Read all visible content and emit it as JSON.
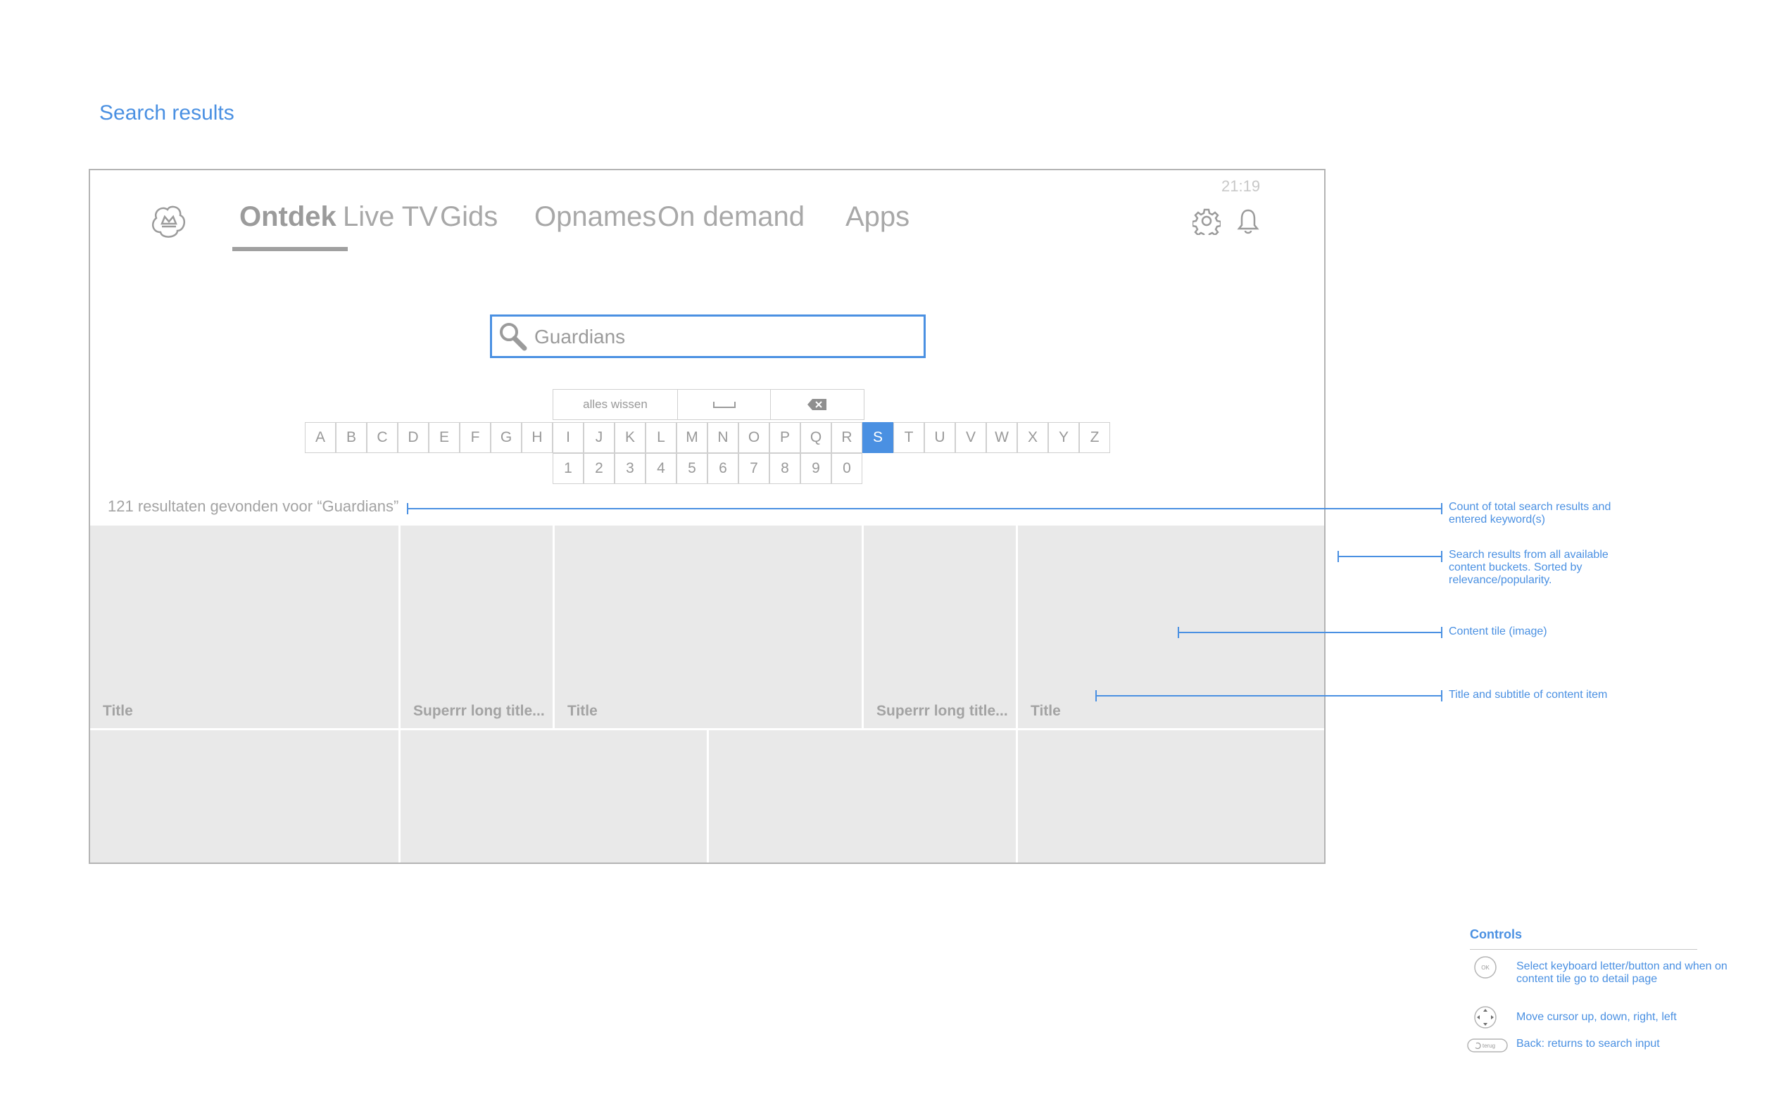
{
  "page": {
    "title": "Search results"
  },
  "tv": {
    "clock": "21:19",
    "nav": [
      "Ontdek",
      "Live TV",
      "Gids",
      "Opnames",
      "On demand",
      "Apps"
    ],
    "search": {
      "value": "Guardians"
    },
    "keyboard": {
      "functions": {
        "clear": "alles wissen"
      },
      "letters": [
        "A",
        "B",
        "C",
        "D",
        "E",
        "F",
        "G",
        "H",
        "I",
        "J",
        "K",
        "L",
        "M",
        "N",
        "O",
        "P",
        "Q",
        "R",
        "S",
        "T",
        "U",
        "V",
        "W",
        "X",
        "Y",
        "Z"
      ],
      "selected": "S",
      "digits": [
        "1",
        "2",
        "3",
        "4",
        "5",
        "6",
        "7",
        "8",
        "9",
        "0"
      ]
    },
    "result_count": "121 resultaten gevonden voor “Guardians”",
    "tiles_row1": [
      "Title",
      "Superrr long title...",
      "Title",
      "Superrr long title...",
      "Title"
    ]
  },
  "annotations": [
    "Count of total search results and entered keyword(s)",
    "Search results from all available content buckets. Sorted by relevance/popularity.",
    "Content tile (image)",
    "Title and subtitle of content item"
  ],
  "controls": {
    "title": "Controls",
    "ok_label": "OK",
    "back_label": "terug",
    "items": [
      "Select keyboard letter/button and when on content tile go to detail page",
      "Move cursor up, down, right, left",
      "Back: returns to search input"
    ]
  },
  "colors": {
    "accent": "#4a90e2",
    "tile": "#e9e9e9",
    "muted_text": "#a3a3a3"
  },
  "icons": [
    "kpn-crown-logo-icon",
    "gear-icon",
    "bell-icon",
    "search-icon",
    "space-bar-icon",
    "backspace-icon",
    "ok-button-icon",
    "dpad-icon",
    "back-button-icon"
  ]
}
